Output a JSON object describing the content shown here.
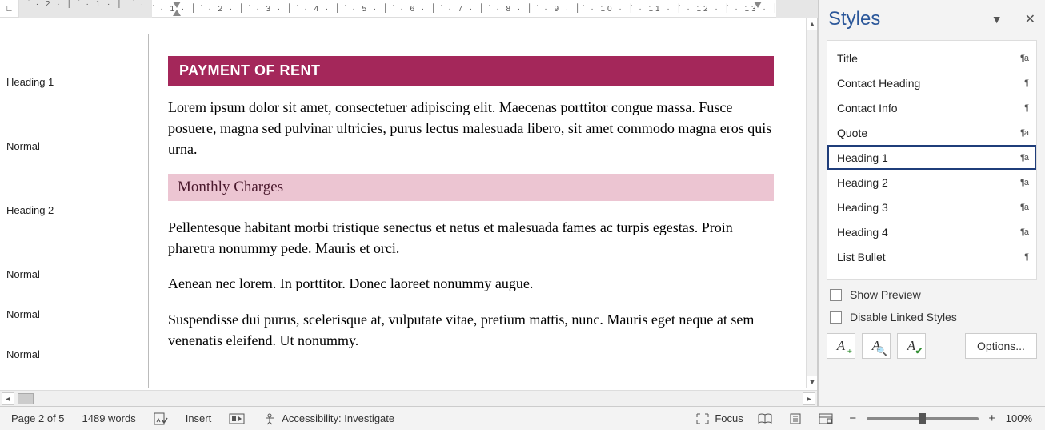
{
  "nav": {
    "items": [
      {
        "label": "Heading 1",
        "gap_after": true
      },
      {
        "label": "Normal",
        "gap_after": true
      },
      {
        "label": "Heading 2",
        "gap_after": true
      },
      {
        "label": "Normal",
        "gap_after": false
      },
      {
        "label": "Normal",
        "gap_after": false
      },
      {
        "label": "Normal",
        "gap_after": false
      }
    ]
  },
  "doc": {
    "h1": "PAYMENT OF RENT",
    "p1": "Lorem ipsum dolor sit amet, consectetuer adipiscing elit. Maecenas porttitor congue massa. Fusce posuere, magna sed pulvinar ultricies, purus lectus malesuada libero, sit amet commodo magna eros quis urna.",
    "h2": "Monthly Charges",
    "p2": "Pellentesque habitant morbi tristique senectus et netus et malesuada fames ac turpis egestas. Proin pharetra nonummy pede. Mauris et orci.",
    "p3": "Aenean nec lorem. In porttitor. Donec laoreet nonummy augue.",
    "p4": "Suspendisse dui purus, scelerisque at, vulputate vitae, pretium mattis, nunc. Mauris eget neque at sem venenatis eleifend. Ut nonummy."
  },
  "ruler": {
    "left_nums": [
      "2",
      "1"
    ],
    "right_nums": [
      "1",
      "2",
      "3",
      "4",
      "5",
      "6",
      "7",
      "8",
      "9",
      "10",
      "11",
      "12",
      "13"
    ]
  },
  "styles_panel": {
    "title": "Styles",
    "items": [
      {
        "name": "Title",
        "glyph": "¶a"
      },
      {
        "name": "Contact Heading",
        "glyph": "¶"
      },
      {
        "name": "Contact Info",
        "glyph": "¶"
      },
      {
        "name": "Quote",
        "glyph": "¶a"
      },
      {
        "name": "Heading 1",
        "glyph": "¶a",
        "selected": true
      },
      {
        "name": "Heading 2",
        "glyph": "¶a"
      },
      {
        "name": "Heading 3",
        "glyph": "¶a"
      },
      {
        "name": "Heading 4",
        "glyph": "¶a"
      },
      {
        "name": "List Bullet",
        "glyph": "¶"
      }
    ],
    "show_preview": "Show Preview",
    "disable_linked": "Disable Linked Styles",
    "options": "Options..."
  },
  "status": {
    "page": "Page 2 of 5",
    "words": "1489 words",
    "insert": "Insert",
    "accessibility": "Accessibility: Investigate",
    "focus": "Focus",
    "zoom": "100%"
  }
}
